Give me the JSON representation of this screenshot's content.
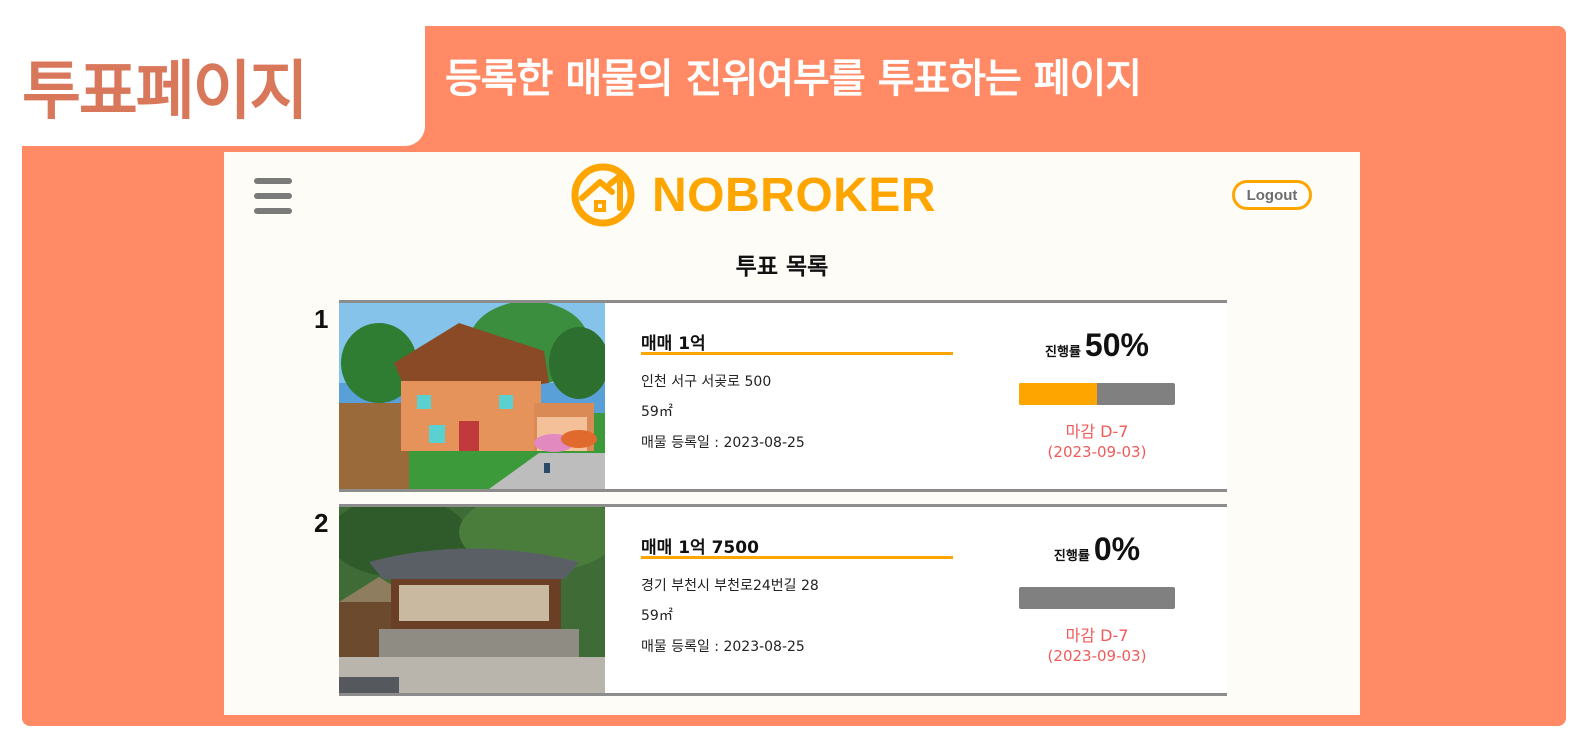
{
  "banner": {
    "page_label": "투표페이지",
    "description": "등록한 매물의 진위여부를 투표하는 페이지"
  },
  "header": {
    "logo_text": "NOBROKER",
    "logout_label": "Logout"
  },
  "main": {
    "list_title": "투표 목록",
    "progress_label": "진행률",
    "items": [
      {
        "index": "1",
        "price": "매매 1억",
        "address": "인천 서구 서곶로 500",
        "area": "59㎡",
        "registered": "매물 등록일 : 2023-08-25",
        "progress_text": "50%",
        "progress_value": 50,
        "deadline": "마감 D-7",
        "deadline_date": "(2023-09-03)"
      },
      {
        "index": "2",
        "price": "매매 1억 7500",
        "address": "경기 부천시 부천로24번길 28",
        "area": "59㎡",
        "registered": "매물 등록일 : 2023-08-25",
        "progress_text": "0%",
        "progress_value": 0,
        "deadline": "마감 D-7",
        "deadline_date": "(2023-09-03)"
      }
    ]
  },
  "colors": {
    "backdrop": "#FF8A65",
    "accent": "#FFA500",
    "deadline": "#F05A5A",
    "track": "#808080"
  },
  "icons": {
    "menu": "hamburger-icon",
    "logo": "house-arrow-logo-icon"
  }
}
